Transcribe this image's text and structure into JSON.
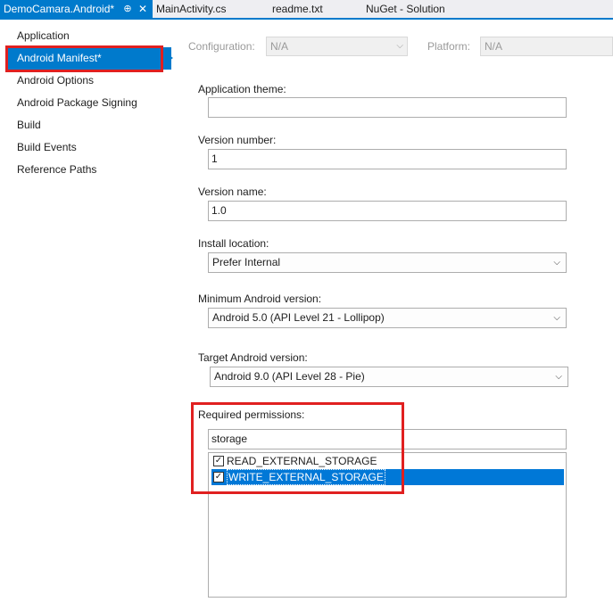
{
  "tabs": [
    {
      "label": "DemoCamara.Android*",
      "active": true
    },
    {
      "label": "MainActivity.cs",
      "active": false
    },
    {
      "label": "readme.txt",
      "active": false
    },
    {
      "label": "NuGet - Solution",
      "active": false
    }
  ],
  "tab_icons": {
    "pin": "pin-icon",
    "close": "close-icon"
  },
  "nav": {
    "items": [
      {
        "label": "Application",
        "selected": false
      },
      {
        "label": "Android Manifest*",
        "selected": true
      },
      {
        "label": "Android Options",
        "selected": false
      },
      {
        "label": "Android Package Signing",
        "selected": false
      },
      {
        "label": "Build",
        "selected": false
      },
      {
        "label": "Build Events",
        "selected": false
      },
      {
        "label": "Reference Paths",
        "selected": false
      }
    ]
  },
  "config": {
    "configuration_label": "Configuration:",
    "configuration_value": "N/A",
    "platform_label": "Platform:",
    "platform_value": "N/A"
  },
  "form": {
    "app_theme_label": "Application theme:",
    "app_theme_value": "",
    "version_number_label": "Version number:",
    "version_number_value": "1",
    "version_name_label": "Version name:",
    "version_name_value": "1.0",
    "install_location_label": "Install location:",
    "install_location_value": "Prefer Internal",
    "min_android_label": "Minimum Android version:",
    "min_android_value": "Android 5.0 (API Level 21 - Lollipop)",
    "target_android_label": "Target Android version:",
    "target_android_value": "Android 9.0 (API Level 28 - Pie)",
    "permissions_label": "Required permissions:",
    "permissions_filter": "storage",
    "permissions": [
      {
        "label": "READ_EXTERNAL_STORAGE",
        "checked": true,
        "selected": false
      },
      {
        "label": "WRITE_EXTERNAL_STORAGE",
        "checked": true,
        "selected": true
      }
    ]
  },
  "colors": {
    "accent": "#007acc",
    "selection": "#0078d7",
    "highlight_box": "#e02020"
  },
  "icons": {
    "dropdown": "chevron-down-icon",
    "check": "checkmark-icon",
    "nav_arrow": "selection-arrow-icon"
  }
}
